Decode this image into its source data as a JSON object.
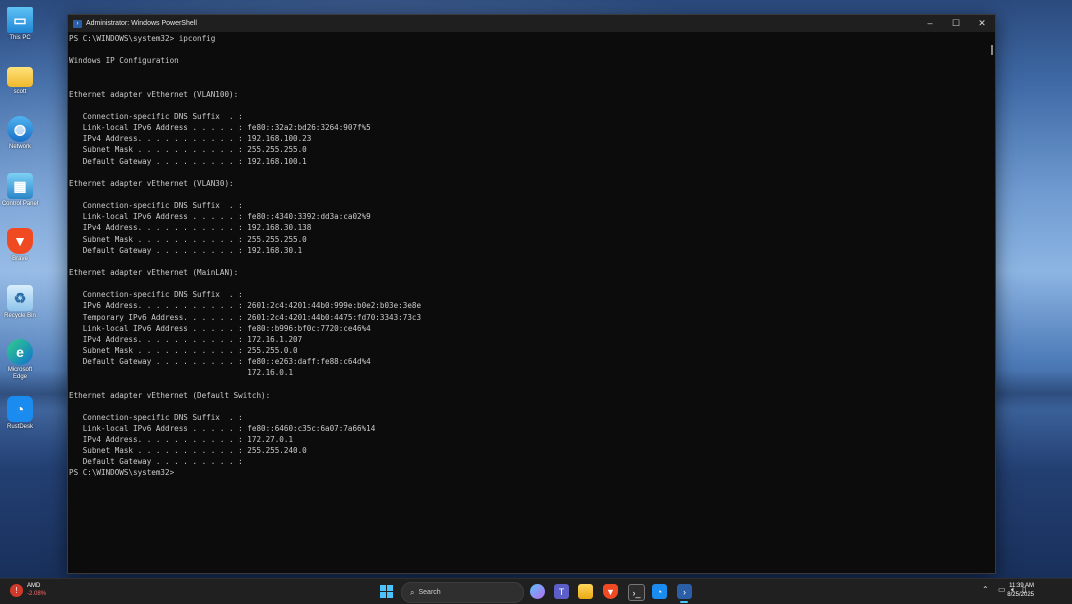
{
  "desktop": {
    "icons": [
      {
        "label": "This PC",
        "icon": "monitor-icon"
      },
      {
        "label": "scott",
        "icon": "folder-icon"
      },
      {
        "label": "Network",
        "icon": "network-icon"
      },
      {
        "label": "Control Panel",
        "icon": "control-panel-icon"
      },
      {
        "label": "Brave",
        "icon": "brave-icon"
      },
      {
        "label": "Recycle Bin",
        "icon": "recycle-bin-icon"
      },
      {
        "label": "Microsoft Edge",
        "icon": "edge-icon"
      },
      {
        "label": "RustDesk",
        "icon": "rustdesk-icon"
      }
    ]
  },
  "window": {
    "title": "Administrator: Windows PowerShell",
    "controls": {
      "minimize": "–",
      "maximize": "☐",
      "close": "✕"
    }
  },
  "console": {
    "lines": [
      "PS C:\\WINDOWS\\system32> ipconfig",
      "",
      "Windows IP Configuration",
      "",
      "",
      "Ethernet adapter vEthernet (VLAN100):",
      "",
      "   Connection-specific DNS Suffix  . :",
      "   Link-local IPv6 Address . . . . . : fe80::32a2:bd26:3264:907f%5",
      "   IPv4 Address. . . . . . . . . . . : 192.168.100.23",
      "   Subnet Mask . . . . . . . . . . . : 255.255.255.0",
      "   Default Gateway . . . . . . . . . : 192.168.100.1",
      "",
      "Ethernet adapter vEthernet (VLAN30):",
      "",
      "   Connection-specific DNS Suffix  . :",
      "   Link-local IPv6 Address . . . . . : fe80::4340:3392:dd3a:ca02%9",
      "   IPv4 Address. . . . . . . . . . . : 192.168.30.138",
      "   Subnet Mask . . . . . . . . . . . : 255.255.255.0",
      "   Default Gateway . . . . . . . . . : 192.168.30.1",
      "",
      "Ethernet adapter vEthernet (MainLAN):",
      "",
      "   Connection-specific DNS Suffix  . :",
      "   IPv6 Address. . . . . . . . . . . : 2601:2c4:4201:44b0:999e:b0e2:b03e:3e8e",
      "   Temporary IPv6 Address. . . . . . : 2601:2c4:4201:44b0:4475:fd70:3343:73c3",
      "   Link-local IPv6 Address . . . . . : fe80::b996:bf0c:7720:ce46%4",
      "   IPv4 Address. . . . . . . . . . . : 172.16.1.207",
      "   Subnet Mask . . . . . . . . . . . : 255.255.0.0",
      "   Default Gateway . . . . . . . . . : fe80::e263:daff:fe88:c64d%4",
      "                                       172.16.0.1",
      "",
      "Ethernet adapter vEthernet (Default Switch):",
      "",
      "   Connection-specific DNS Suffix  . :",
      "   Link-local IPv6 Address . . . . . : fe80::6460:c35c:6a07:7a66%14",
      "   IPv4 Address. . . . . . . . . . . : 172.27.0.1",
      "   Subnet Mask . . . . . . . . . . . : 255.255.240.0",
      "   Default Gateway . . . . . . . . . :",
      "PS C:\\WINDOWS\\system32>"
    ]
  },
  "taskbar": {
    "weather": {
      "name": "AMD",
      "change": "-2.08%"
    },
    "search_placeholder": "Search",
    "pinned": [
      "start-icon",
      "search-box",
      "copilot-icon",
      "teams-icon",
      "file-explorer-icon",
      "brave-icon",
      "terminal-icon",
      "rustdesk-icon",
      "powershell-icon"
    ],
    "clock": {
      "time": "11:39 AM",
      "date": "8/25/2025"
    }
  },
  "colors": {
    "console_bg": "#0c0c0c",
    "console_text": "#cccccc",
    "taskbar_bg": "#202020",
    "accent": "#4cc2ff"
  }
}
